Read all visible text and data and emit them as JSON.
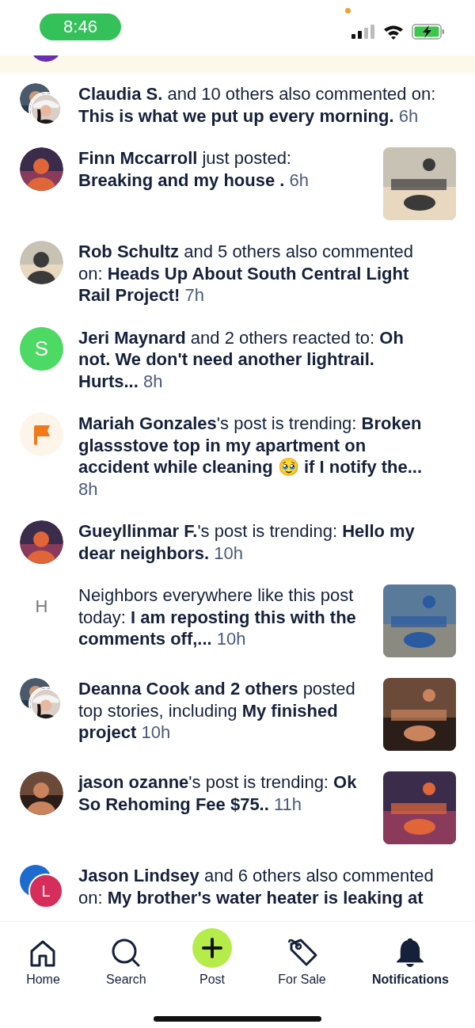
{
  "status_bar": {
    "time": "8:46"
  },
  "notifications": [
    {
      "avatar": {
        "kind": "pair"
      },
      "text": "**Claudia S.** and 10 others also commented on: **This is what we put up every morning.**",
      "time": "6h",
      "has_thumbnail": false
    },
    {
      "text": "**Finn Mccarroll** just posted: **Breaking and my house .**",
      "time": "6h",
      "has_thumbnail": true
    },
    {
      "text": "**Rob Schultz** and 5 others also commented on: **Heads Up About South Central Light Rail Project!**",
      "time": "7h",
      "has_thumbnail": false
    },
    {
      "avatar": {
        "kind": "letter",
        "letter": "S",
        "color": "#4cd964"
      },
      "text": "**Jeri Maynard** and 2 others reacted to: **Oh not. We don't need another lightrail. Hurts...**",
      "time": "8h",
      "has_thumbnail": false
    },
    {
      "avatar": {
        "kind": "flag"
      },
      "text": "**Mariah Gonzales**'s post is trending: **Broken glassstove top in my apartment on accident while cleaning 🥹 if I notify the...**",
      "time": "8h",
      "has_thumbnail": false
    },
    {
      "text": "**Gueyllinmar F.**'s post is trending: **Hello my dear neighbors.**",
      "time": "10h",
      "has_thumbnail": false
    },
    {
      "avatar": {
        "kind": "initial",
        "letter": "H"
      },
      "text": "Neighbors everywhere like this post today: **I am reposting this with the comments off,...**",
      "time": "10h",
      "has_thumbnail": true
    },
    {
      "avatar": {
        "kind": "pair"
      },
      "text": "**Deanna Cook and 2 others** posted top stories, including **My finished project**",
      "time": "10h",
      "has_thumbnail": true
    },
    {
      "text": "**jason ozanne**'s post is trending: **Ok So Rehoming Fee  $75..**",
      "time": "11h",
      "has_thumbnail": true
    },
    {
      "avatar": {
        "kind": "pair",
        "back": {
          "kind": "circle",
          "color": "#1c6cd0"
        },
        "front": {
          "kind": "letter",
          "letter": "L",
          "color": "#d62d5a"
        }
      },
      "text": "**Jason Lindsey** and 6 others also commented on: **My brother's water heater is leaking at**",
      "has_thumbnail": false
    }
  ],
  "nav": [
    {
      "kind": "home",
      "label": "Home",
      "selected": false
    },
    {
      "kind": "search",
      "label": "Search",
      "selected": false
    },
    {
      "kind": "post",
      "label": "Post",
      "selected": false
    },
    {
      "kind": "tag",
      "label": "For Sale",
      "selected": false
    },
    {
      "kind": "bell",
      "label": "Notifications",
      "selected": true
    }
  ]
}
